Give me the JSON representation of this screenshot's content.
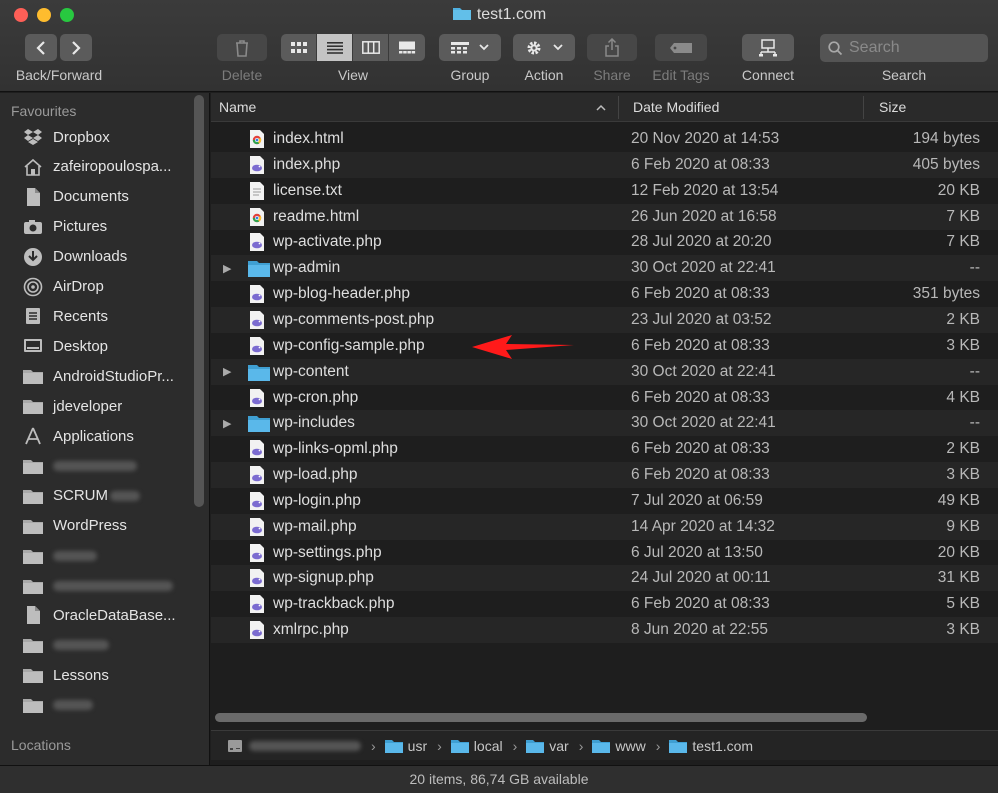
{
  "window": {
    "title": "test1.com"
  },
  "toolbar": {
    "back_forward_label": "Back/Forward",
    "delete_label": "Delete",
    "view_label": "View",
    "group_label": "Group",
    "action_label": "Action",
    "share_label": "Share",
    "edit_tags_label": "Edit Tags",
    "connect_label": "Connect",
    "search_label": "Search",
    "search_placeholder": "Search"
  },
  "sidebar": {
    "favourites_heading": "Favourites",
    "locations_heading": "Locations",
    "items": [
      {
        "label": "Dropbox",
        "icon": "dropbox-icon"
      },
      {
        "label": "zafeiropoulospa...",
        "icon": "home-icon"
      },
      {
        "label": "Documents",
        "icon": "document-icon"
      },
      {
        "label": "Pictures",
        "icon": "camera-icon"
      },
      {
        "label": "Downloads",
        "icon": "download-icon"
      },
      {
        "label": "AirDrop",
        "icon": "airdrop-icon"
      },
      {
        "label": "Recents",
        "icon": "recents-icon"
      },
      {
        "label": "Desktop",
        "icon": "desktop-icon"
      },
      {
        "label": "AndroidStudioPr...",
        "icon": "folder-icon"
      },
      {
        "label": "jdeveloper",
        "icon": "folder-icon"
      },
      {
        "label": "Applications",
        "icon": "applications-icon"
      },
      {
        "label": "",
        "icon": "folder-icon"
      },
      {
        "label": "SCRUM",
        "icon": "folder-icon"
      },
      {
        "label": "WordPress",
        "icon": "folder-icon"
      },
      {
        "label": "",
        "icon": "folder-icon"
      },
      {
        "label": "",
        "icon": "folder-icon"
      },
      {
        "label": "OracleDataBase...",
        "icon": "document-icon"
      },
      {
        "label": "",
        "icon": "folder-icon"
      },
      {
        "label": "Lessons",
        "icon": "folder-icon"
      },
      {
        "label": "",
        "icon": "folder-icon"
      }
    ]
  },
  "columns": {
    "name": "Name",
    "date": "Date Modified",
    "size": "Size"
  },
  "files": [
    {
      "name": "index.html",
      "date": "20 Nov 2020 at 14:53",
      "size": "194 bytes",
      "kind": "html"
    },
    {
      "name": "index.php",
      "date": "6 Feb 2020 at 08:33",
      "size": "405 bytes",
      "kind": "php"
    },
    {
      "name": "license.txt",
      "date": "12 Feb 2020 at 13:54",
      "size": "20 KB",
      "kind": "txt"
    },
    {
      "name": "readme.html",
      "date": "26 Jun 2020 at 16:58",
      "size": "7 KB",
      "kind": "html"
    },
    {
      "name": "wp-activate.php",
      "date": "28 Jul 2020 at 20:20",
      "size": "7 KB",
      "kind": "php"
    },
    {
      "name": "wp-admin",
      "date": "30 Oct 2020 at 22:41",
      "size": "--",
      "kind": "folder"
    },
    {
      "name": "wp-blog-header.php",
      "date": "6 Feb 2020 at 08:33",
      "size": "351 bytes",
      "kind": "php"
    },
    {
      "name": "wp-comments-post.php",
      "date": "23 Jul 2020 at 03:52",
      "size": "2 KB",
      "kind": "php"
    },
    {
      "name": "wp-config-sample.php",
      "date": "6 Feb 2020 at 08:33",
      "size": "3 KB",
      "kind": "php"
    },
    {
      "name": "wp-content",
      "date": "30 Oct 2020 at 22:41",
      "size": "--",
      "kind": "folder"
    },
    {
      "name": "wp-cron.php",
      "date": "6 Feb 2020 at 08:33",
      "size": "4 KB",
      "kind": "php"
    },
    {
      "name": "wp-includes",
      "date": "30 Oct 2020 at 22:41",
      "size": "--",
      "kind": "folder"
    },
    {
      "name": "wp-links-opml.php",
      "date": "6 Feb 2020 at 08:33",
      "size": "2 KB",
      "kind": "php"
    },
    {
      "name": "wp-load.php",
      "date": "6 Feb 2020 at 08:33",
      "size": "3 KB",
      "kind": "php"
    },
    {
      "name": "wp-login.php",
      "date": "7 Jul 2020 at 06:59",
      "size": "49 KB",
      "kind": "php"
    },
    {
      "name": "wp-mail.php",
      "date": "14 Apr 2020 at 14:32",
      "size": "9 KB",
      "kind": "php"
    },
    {
      "name": "wp-settings.php",
      "date": "6 Jul 2020 at 13:50",
      "size": "20 KB",
      "kind": "php"
    },
    {
      "name": "wp-signup.php",
      "date": "24 Jul 2020 at 00:11",
      "size": "31 KB",
      "kind": "php"
    },
    {
      "name": "wp-trackback.php",
      "date": "6 Feb 2020 at 08:33",
      "size": "5 KB",
      "kind": "php"
    },
    {
      "name": "xmlrpc.php",
      "date": "8 Jun 2020 at 22:55",
      "size": "3 KB",
      "kind": "php"
    }
  ],
  "pathbar": [
    "usr",
    "local",
    "var",
    "www",
    "test1.com"
  ],
  "status": "20 items, 86,74 GB available",
  "colors": {
    "folder": "#4fb0e0",
    "annotation_arrow": "#ff1a1a",
    "php_icon": "#7b6bd0"
  }
}
